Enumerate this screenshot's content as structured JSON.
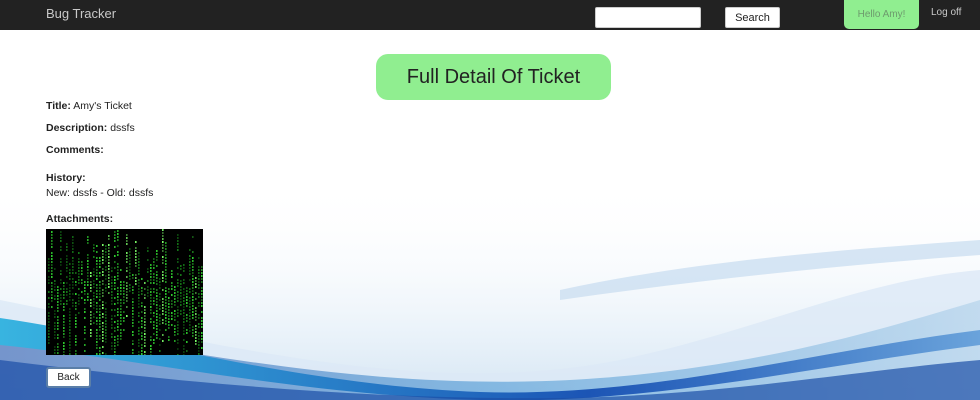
{
  "navbar": {
    "brand": "Bug Tracker",
    "search_value": "",
    "search_button": "Search",
    "greeting": "Hello Amy!",
    "logoff": "Log off"
  },
  "page": {
    "heading": "Full Detail Of Ticket"
  },
  "ticket": {
    "title_label": "Title:",
    "title_value": "Amy's Ticket",
    "description_label": "Description:",
    "description_value": "dssfs",
    "comments_label": "Comments:",
    "history_label": "History:",
    "history_entry": "New: dssfs - Old: dssfs",
    "attachments_label": "Attachments:"
  },
  "actions": {
    "back": "Back"
  },
  "colors": {
    "navbar": "#222222",
    "accent_green": "#90ee90",
    "wave_blue": "#2a5fb8",
    "wave_cyan": "#38a8d8"
  }
}
